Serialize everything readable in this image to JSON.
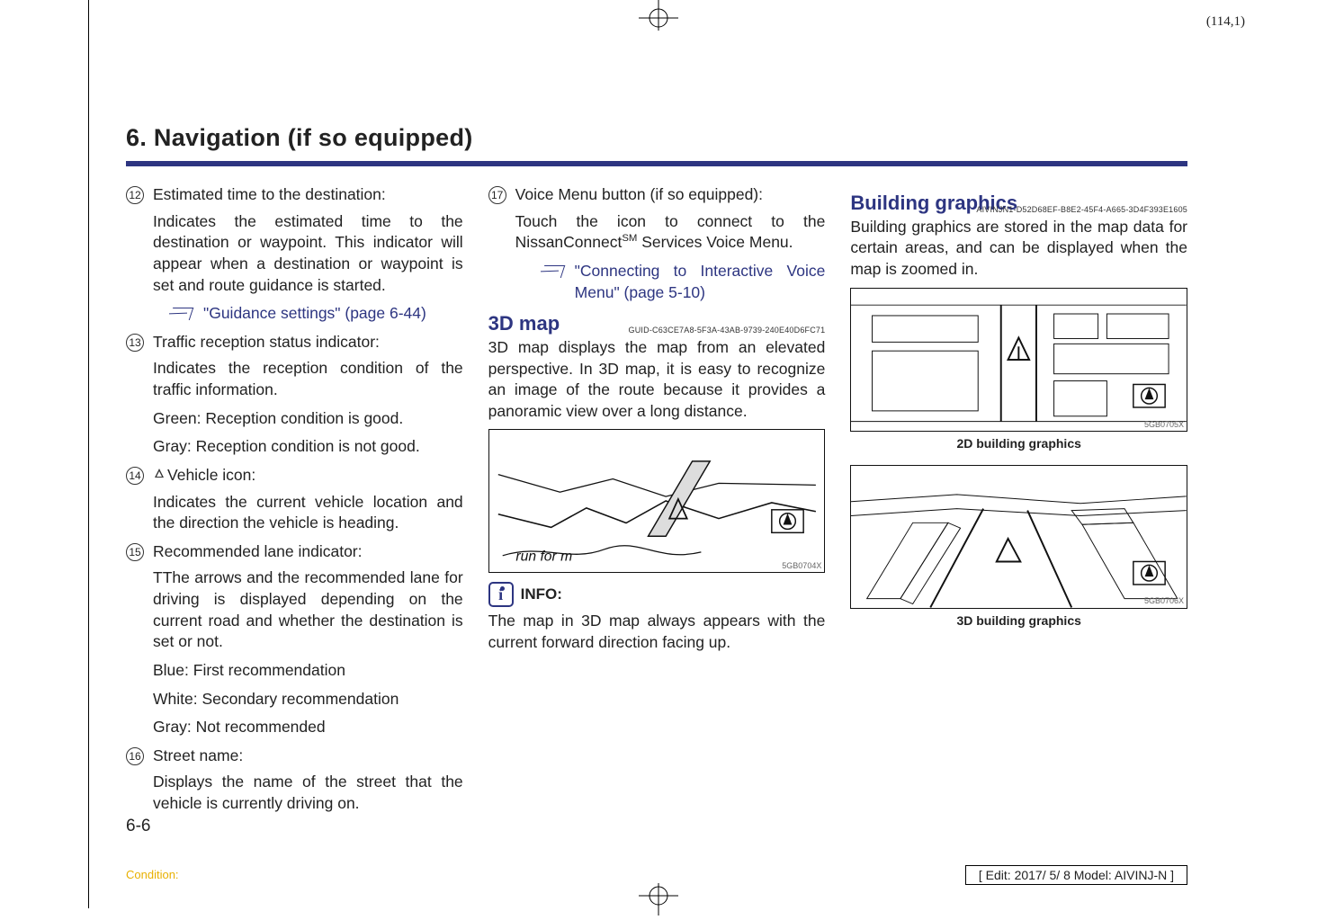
{
  "top_marker": "(114,1)",
  "chapter_title": "6. Navigation (if so equipped)",
  "col1": {
    "i12": {
      "num": "12",
      "title": "Estimated time to the destination:",
      "p": "Indicates the estimated time to the destination or waypoint. This indicator will appear when a destination or waypoint is set and route guidance is started.",
      "xref": "\"Guidance settings\" (page 6-44)"
    },
    "i13": {
      "num": "13",
      "title": "Traffic reception status indicator:",
      "p1": "Indicates the reception condition of the traffic information.",
      "p2": "Green: Reception condition is good.",
      "p3": "Gray: Reception condition is not good."
    },
    "i14": {
      "num": "14",
      "title": "Vehicle icon:",
      "p": "Indicates the current vehicle location and the direction the vehicle is heading."
    },
    "i15": {
      "num": "15",
      "title": "Recommended lane indicator:",
      "p1": "TThe arrows and the recommended lane for driving is displayed depending on the current road and whether the destination is set or not.",
      "p2": "Blue: First recommendation",
      "p3": "White: Secondary recommendation",
      "p4": "Gray: Not recommended"
    },
    "i16": {
      "num": "16",
      "title": "Street name:",
      "p": "Displays the name of the street that the vehicle is currently driving on."
    }
  },
  "col2": {
    "i17": {
      "num": "17",
      "title": "Voice Menu button (if so equipped):",
      "p_pre": "Touch the icon to connect to the NissanConnect",
      "p_sup": "SM",
      "p_post": " Services Voice Menu.",
      "xref": "\"Connecting to Interactive Voice Menu\" (page 5-10)"
    },
    "h_3d": "3D map",
    "guid_3d": "GUID-C63CE7A8-5F3A-43AB-9739-240E40D6FC71",
    "p_3d": "3D map displays the map from an elevated perspective. In 3D map, it is easy to recognize an image of the route because it provides a panoramic view over a long distance.",
    "fig1_code": "5GB0704X",
    "info_label": "INFO:",
    "info_p": "The map in 3D map always appears with the current forward direction facing up."
  },
  "col3": {
    "h_bg": "Building graphics",
    "guid_bg": "AIVINJN1-D52D68EF-B8E2-45F4-A665-3D4F393E1605",
    "p_bg": "Building graphics are stored in the map data for certain areas, and can be displayed when the map is zoomed in.",
    "fig2_code": "5GB0705X",
    "cap2": "2D building graphics",
    "fig3_code": "5GB0706X",
    "cap3": "3D building graphics"
  },
  "page_no": "6-6",
  "condition_label": "Condition:",
  "edit_info": "[ Edit: 2017/ 5/ 8   Model: AIVINJ-N ]"
}
